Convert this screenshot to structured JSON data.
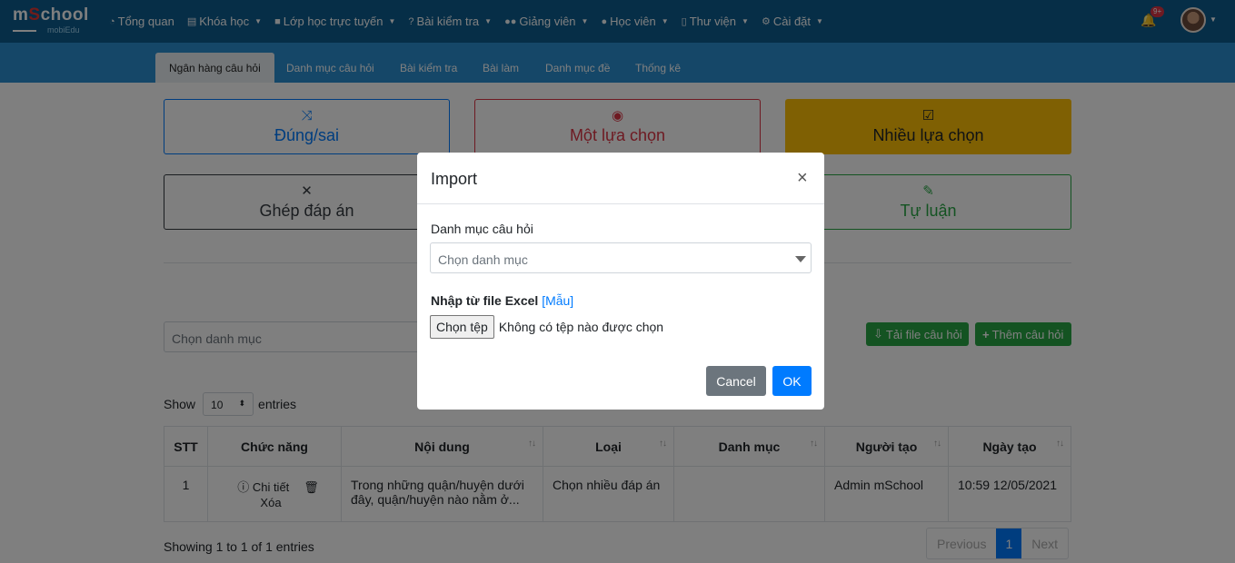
{
  "brand": {
    "logo_main": "mSchool",
    "logo_sub": "mobiEdu"
  },
  "nav": {
    "items": [
      {
        "icon": "dashboard-icon",
        "label": "Tổng quan"
      },
      {
        "icon": "book-icon",
        "label": "Khóa học"
      },
      {
        "icon": "video-icon",
        "label": "Lớp học trực tuyến"
      },
      {
        "icon": "question-icon",
        "label": "Bài kiểm tra"
      },
      {
        "icon": "users-icon",
        "label": "Giảng viên"
      },
      {
        "icon": "user-icon",
        "label": "Học viên"
      },
      {
        "icon": "library-icon",
        "label": "Thư viện"
      },
      {
        "icon": "gear-icon",
        "label": "Cài đặt"
      }
    ],
    "notification_badge": "9+"
  },
  "subtabs": [
    "Ngân hàng câu hỏi",
    "Danh mục câu hỏi",
    "Bài kiểm tra",
    "Bài làm",
    "Danh mục đề",
    "Thống kê"
  ],
  "question_types": {
    "true_false": "Đúng/sai",
    "single_choice": "Một lựa chọn",
    "multiple_choice": "Nhiều lựa chọn",
    "matching": "Ghép đáp án",
    "essay": "Tự luận"
  },
  "filter": {
    "placeholder": "Chọn danh mục"
  },
  "actions": {
    "download": "Tải file câu hỏi",
    "add": "Thêm câu hỏi"
  },
  "length": {
    "show": "Show",
    "value": "10",
    "entries": "entries"
  },
  "table": {
    "headers": [
      "STT",
      "Chức năng",
      "Nội dung",
      "Loại",
      "Danh mục",
      "Người tạo",
      "Ngày tạo"
    ],
    "rows": [
      {
        "stt": "1",
        "detail": "Chi tiết",
        "delete": "Xóa",
        "content": "Trong những quận/huyện dưới đây, quận/huyện nào nằm ở...",
        "type": "Chọn nhiều đáp án",
        "category": "",
        "creator": "Admin mSchool",
        "created": "10:59 12/05/2021"
      }
    ]
  },
  "pagination": {
    "info": "Showing 1 to 1 of 1 entries",
    "previous": "Previous",
    "current": "1",
    "next": "Next"
  },
  "modal": {
    "title": "Import",
    "close": "×",
    "category_label": "Danh mục câu hỏi",
    "category_placeholder": "Chọn danh mục",
    "excel_label": "Nhập từ file Excel",
    "template_link": "[Mẫu]",
    "file_button": "Chọn tệp",
    "file_status": "Không có tệp nào được chọn",
    "cancel": "Cancel",
    "ok": "OK"
  },
  "colors": {
    "navbar": "#0d5d8f",
    "subbar": "#2b8fd0",
    "primary": "#007bff",
    "danger": "#dc3545",
    "warning": "#ffc107",
    "success": "#28a745",
    "secondary": "#6c757d"
  }
}
